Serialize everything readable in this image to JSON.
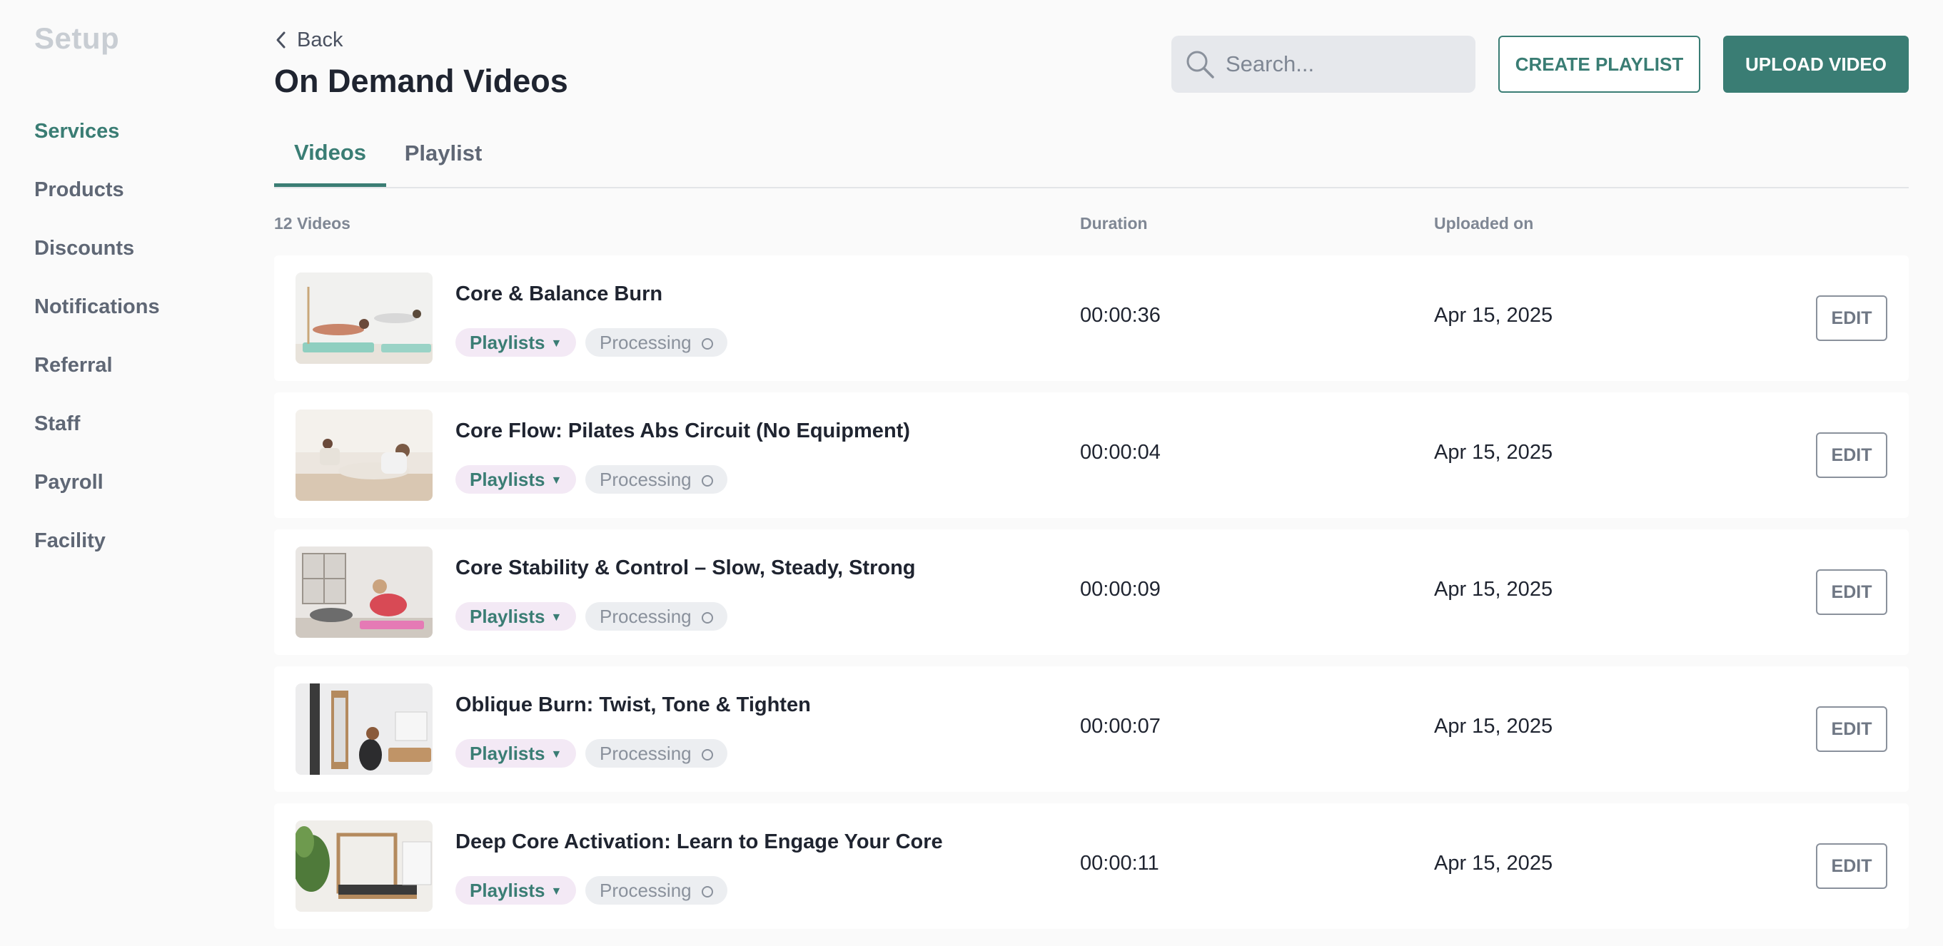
{
  "sidebar": {
    "title": "Setup",
    "items": [
      {
        "label": "Services"
      },
      {
        "label": "Products"
      },
      {
        "label": "Discounts"
      },
      {
        "label": "Notifications"
      },
      {
        "label": "Referral"
      },
      {
        "label": "Staff"
      },
      {
        "label": "Payroll"
      },
      {
        "label": "Facility"
      }
    ]
  },
  "header": {
    "back_label": "Back",
    "title": "On Demand Videos",
    "search_placeholder": "Search...",
    "create_playlist_label": "CREATE PLAYLIST",
    "upload_video_label": "UPLOAD VIDEO"
  },
  "tabs": [
    {
      "label": "Videos",
      "active": true
    },
    {
      "label": "Playlist",
      "active": false
    }
  ],
  "list": {
    "count_label": "12 Videos",
    "duration_header": "Duration",
    "uploaded_header": "Uploaded on",
    "playlists_chip": "Playlists",
    "processing_chip": "Processing",
    "edit_label": "EDIT",
    "rows": [
      {
        "title": "Core & Balance Burn",
        "duration": "00:00:36",
        "uploaded": "Apr 15, 2025"
      },
      {
        "title": "Core Flow: Pilates Abs Circuit (No Equipment)",
        "duration": "00:00:04",
        "uploaded": "Apr 15, 2025"
      },
      {
        "title": "Core Stability & Control – Slow, Steady, Strong",
        "duration": "00:00:09",
        "uploaded": "Apr 15, 2025"
      },
      {
        "title": "Oblique Burn: Twist, Tone & Tighten",
        "duration": "00:00:07",
        "uploaded": "Apr 15, 2025"
      },
      {
        "title": "Deep Core Activation: Learn to Engage Your Core",
        "duration": "00:00:11",
        "uploaded": "Apr 15, 2025"
      }
    ]
  },
  "colors": {
    "accent": "#3a7d74",
    "playlists_chip_bg": "#f3e9f5",
    "processing_chip_bg": "#eceef1"
  }
}
